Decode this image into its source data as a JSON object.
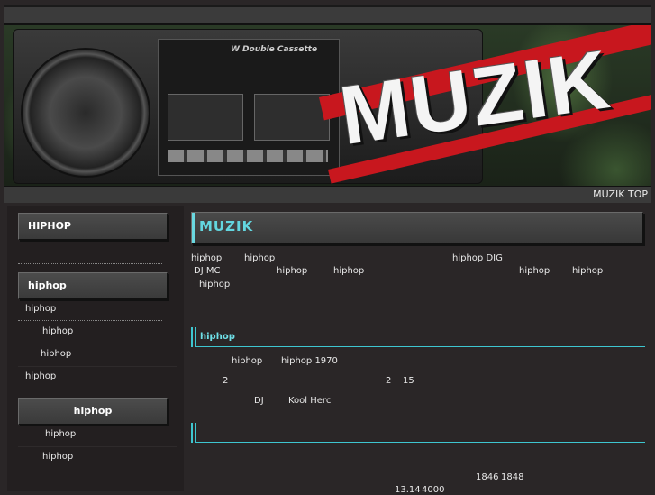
{
  "banner": {
    "logo": "MUZIK",
    "deck_label": "W Double Cassette"
  },
  "nav": {
    "top_link": "MUZIK TOP"
  },
  "sidebar": {
    "section1": "HIPHOP",
    "section2": "hiphop",
    "section2_items": [
      "hiphop",
      "hiphop",
      "hiphop",
      "hiphop"
    ],
    "section3": "hiphop",
    "section3_items": [
      "hiphop",
      "hiphop"
    ]
  },
  "main": {
    "title": "MUZIK",
    "intro": {
      "line1": [
        "hiphop",
        "hiphop",
        "hiphop DIG"
      ],
      "line2": [
        "DJ  MC",
        "hiphop",
        "hiphop",
        "hiphop",
        "hiphop"
      ],
      "line3": [
        "hiphop"
      ]
    },
    "section1_title": "hiphop",
    "section1": {
      "line1": [
        "hiphop",
        "hiphop 1970"
      ],
      "line2": [
        "2",
        "2",
        "15"
      ],
      "line3": [
        "DJ",
        "Kool Herc"
      ]
    },
    "section2_title": "",
    "section2": {
      "line1": [
        "1846",
        "1848"
      ],
      "line2": [
        "13.14",
        "4000"
      ]
    }
  }
}
